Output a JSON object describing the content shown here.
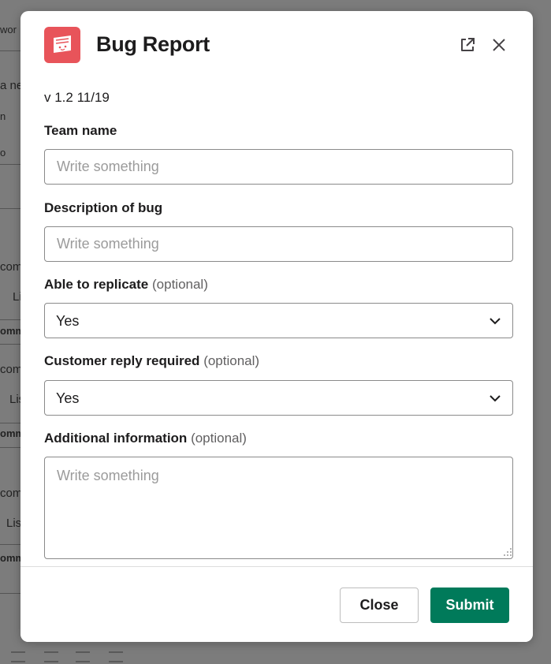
{
  "background": {
    "fragments": [
      "wor",
      "a ne",
      "n",
      "o",
      "com",
      "Li",
      "omm",
      "com",
      "Lis",
      "omm",
      "com",
      "Lis",
      "omm"
    ]
  },
  "modal": {
    "title": "Bug Report",
    "version": "v 1.2 11/19",
    "fields": {
      "team_name": {
        "label": "Team name",
        "placeholder": "Write something",
        "value": ""
      },
      "description": {
        "label": "Description of bug",
        "placeholder": "Write something",
        "value": ""
      },
      "replicate": {
        "label": "Able to replicate",
        "optional": "(optional)",
        "value": "Yes"
      },
      "customer_reply": {
        "label": "Customer reply required",
        "optional": "(optional)",
        "value": "Yes"
      },
      "additional": {
        "label": "Additional information",
        "optional": "(optional)",
        "placeholder": "Write something",
        "value": ""
      }
    },
    "buttons": {
      "close": "Close",
      "submit": "Submit"
    }
  },
  "colors": {
    "accent": "#007a5a",
    "brand_icon": "#e8545a",
    "overlay": "#7b7b7b"
  },
  "icons": {
    "app": "app-logo-icon",
    "external": "external-link-icon",
    "close": "close-icon",
    "select": "chevron-down-icon",
    "resize": "resize-handle-icon"
  }
}
